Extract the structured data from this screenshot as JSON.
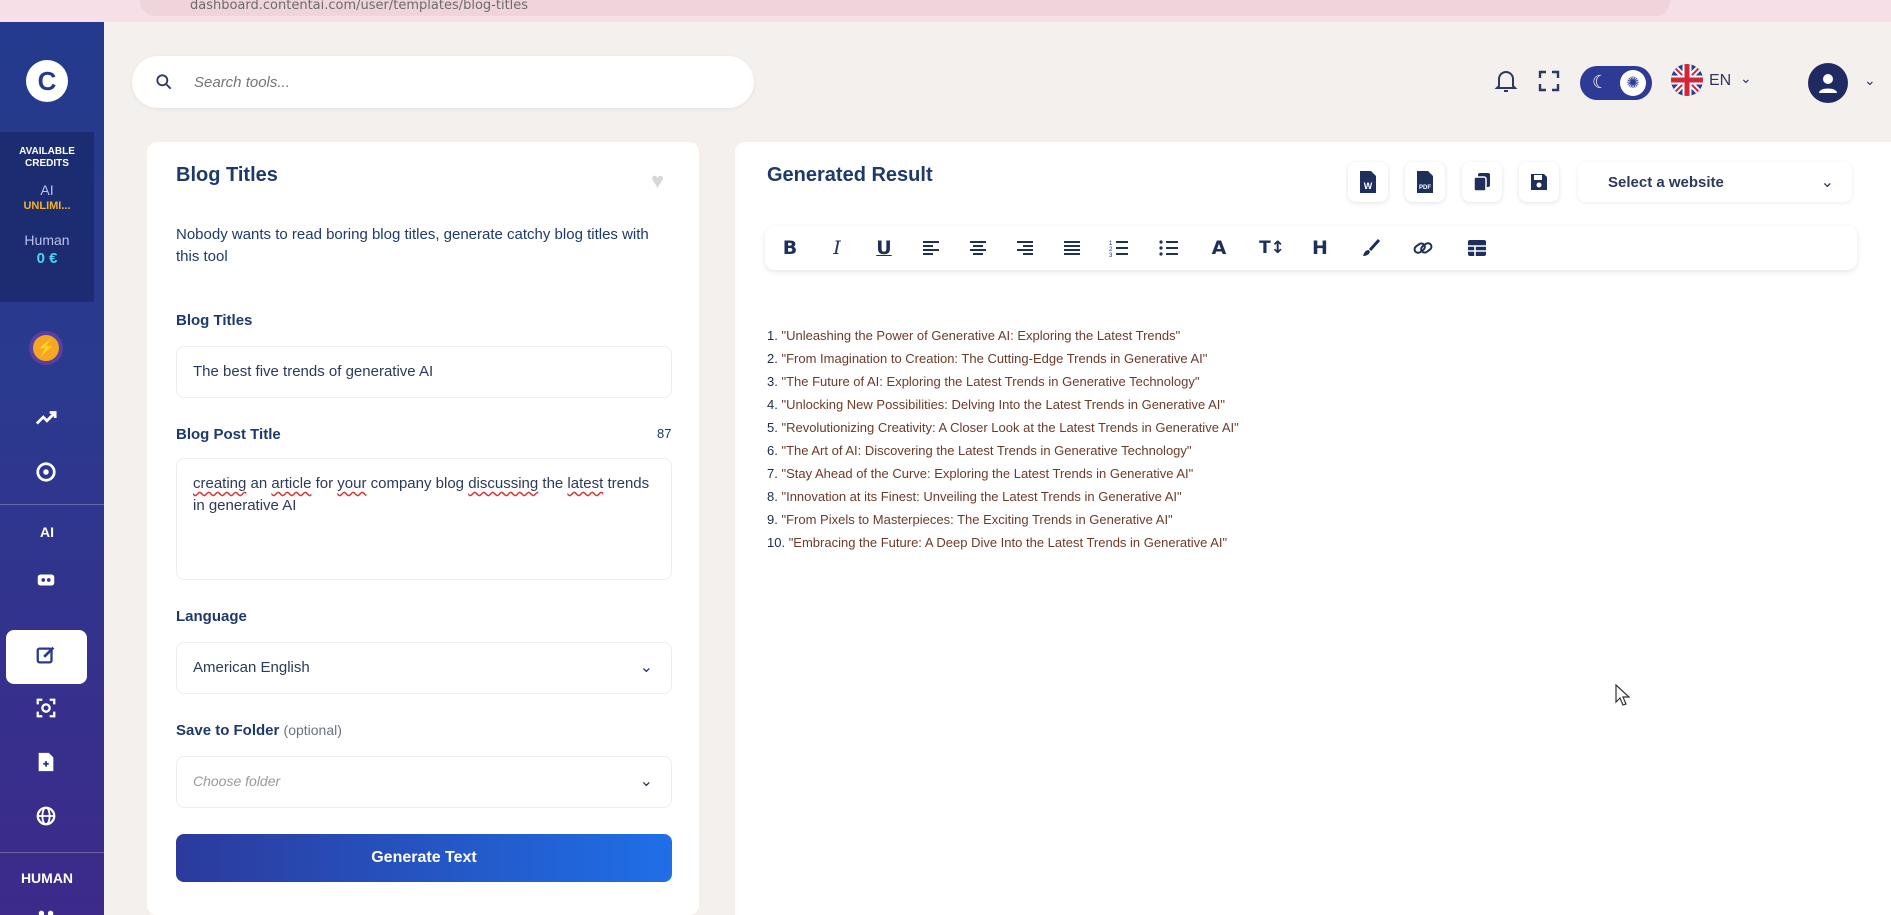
{
  "browser": {
    "url": "dashboard.contentai.com/user/templates/blog-titles"
  },
  "sidebar": {
    "credits_label": "AVAILABLE CREDITS",
    "ai_label": "AI",
    "ai_value": "UNLIMI...",
    "human_label": "Human",
    "human_value": "0 €",
    "section_ai": "AI",
    "section_human": "HUMAN"
  },
  "search": {
    "placeholder": "Search tools..."
  },
  "header": {
    "language": "EN"
  },
  "form": {
    "title": "Blog Titles",
    "description": "Nobody wants to read boring blog titles, generate catchy blog titles with this tool",
    "blog_titles_label": "Blog Titles",
    "blog_titles_value": "The best five trends of generative AI",
    "post_title_label": "Blog Post Title",
    "post_title_count": "87",
    "post_title_words": [
      "creating",
      " an ",
      "article",
      " for ",
      "your",
      " company blog ",
      "discussing",
      " the ",
      "latest",
      " trends in generative AI"
    ],
    "language_label": "Language",
    "language_value": "American English",
    "folder_label": "Save to Folder",
    "folder_optional": "(optional)",
    "folder_placeholder": "Choose folder",
    "generate_label": "Generate Text"
  },
  "result": {
    "title": "Generated Result",
    "website_select": "Select a website",
    "items": [
      "\"Unleashing the Power of Generative AI: Exploring the Latest Trends\"",
      "\"From Imagination to Creation: The Cutting-Edge Trends in Generative AI\"",
      "\"The Future of AI: Exploring the Latest Trends in Generative Technology\"",
      "\"Unlocking New Possibilities: Delving Into the Latest Trends in Generative AI\"",
      "\"Revolutionizing Creativity: A Closer Look at the Latest Trends in Generative AI\"",
      "\"The Art of AI: Discovering the Latest Trends in Generative Technology\"",
      "\"Stay Ahead of the Curve: Exploring the Latest Trends in Generative AI\"",
      "\"Innovation at its Finest: Unveiling the Latest Trends in Generative AI\"",
      "\"From Pixels to Masterpieces: The Exciting Trends in Generative AI\"",
      "\"Embracing the Future: A Deep Dive Into the Latest Trends in Generative AI\""
    ]
  },
  "toolbar": {
    "bold": "B",
    "italic": "I",
    "underline": "U",
    "font": "A",
    "size": "T↕",
    "heading": "H"
  },
  "colors": {
    "accent": "#2d3a96",
    "sidebar": "#243a8c",
    "button_end": "#1f6fe8",
    "generated_text": "#6b3b2a"
  }
}
